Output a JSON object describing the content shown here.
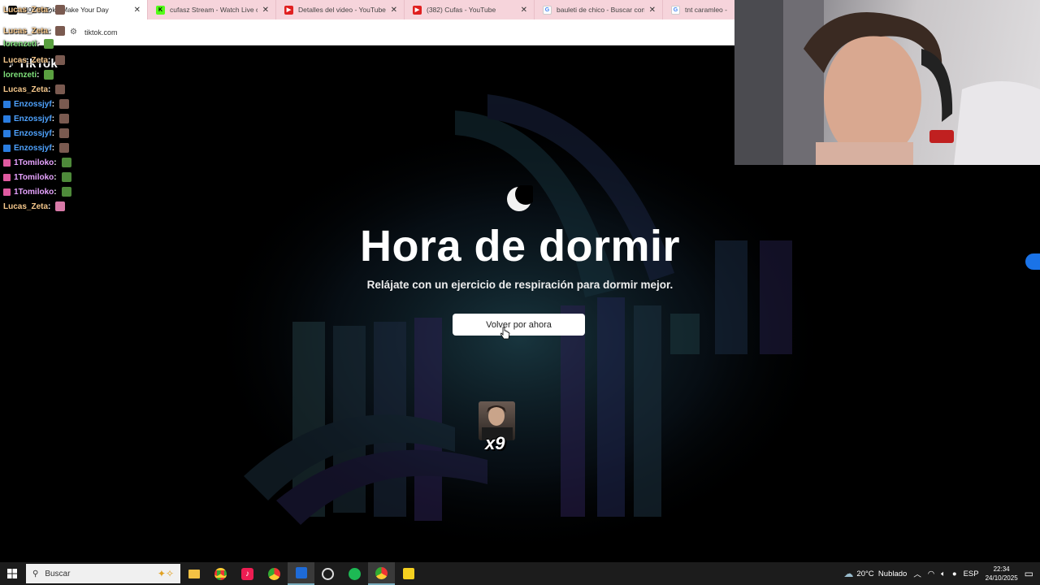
{
  "browser": {
    "tabs": [
      {
        "label": "(40) TikTok - Make Your Day",
        "favicon": "tiktok-icon",
        "active": true
      },
      {
        "label": "cufasz Stream - Watch Live on K",
        "favicon": "kick-icon",
        "active": false
      },
      {
        "label": "Detalles del video - YouTube St",
        "favicon": "youtube-icon",
        "active": false
      },
      {
        "label": "(382) Cufas - YouTube",
        "favicon": "youtube-icon",
        "active": false
      },
      {
        "label": "bauleti de chico - Buscar con G",
        "favicon": "google-icon",
        "active": false
      },
      {
        "label": "tnt caramleo - Bus",
        "favicon": "google-icon",
        "active": false
      }
    ],
    "url": "tiktok.com"
  },
  "chat": [
    {
      "user": "Lucas_Zeta",
      "color": "#f6c88c",
      "badge": "",
      "emote": "face"
    },
    {
      "user": "Lucas_Zeta",
      "color": "#f6c88c",
      "badge": "",
      "emote": "face"
    },
    {
      "user": "lorenzeti",
      "color": "#7ee07a",
      "badge": "",
      "emote": "pepe"
    },
    {
      "user": "Lucas_Zeta",
      "color": "#f6c88c",
      "badge": "",
      "emote": "face"
    },
    {
      "user": "lorenzeti",
      "color": "#7ee07a",
      "badge": "",
      "emote": "pepe"
    },
    {
      "user": "Lucas_Zeta",
      "color": "#f6c88c",
      "badge": "",
      "emote": "face"
    },
    {
      "user": "Enzossjyf",
      "color": "#4fa3ff",
      "badge": "#2a7de1",
      "emote": "face"
    },
    {
      "user": "Enzossjyf",
      "color": "#4fa3ff",
      "badge": "#2a7de1",
      "emote": "face"
    },
    {
      "user": "Enzossjyf",
      "color": "#4fa3ff",
      "badge": "#2a7de1",
      "emote": "face"
    },
    {
      "user": "Enzossjyf",
      "color": "#4fa3ff",
      "badge": "#2a7de1",
      "emote": "face"
    },
    {
      "user": "1Tomiloko",
      "color": "#e7a3ff",
      "badge": "#e05aa0",
      "emote": "frog"
    },
    {
      "user": "1Tomiloko",
      "color": "#e7a3ff",
      "badge": "#e05aa0",
      "emote": "frog"
    },
    {
      "user": "1Tomiloko",
      "color": "#e7a3ff",
      "badge": "#e05aa0",
      "emote": "frog"
    },
    {
      "user": "Lucas_Zeta",
      "color": "#f6c88c",
      "badge": "",
      "emote": "pink"
    }
  ],
  "chat_separator": " :",
  "tiktok_logo": "TikTok",
  "main": {
    "title": "Hora de dormir",
    "subtitle": "Relájate con un ejercicio de respiración para dormir mejor.",
    "back_button": "Volver por ahora"
  },
  "overlay": {
    "emote_count": "x9"
  },
  "taskbar": {
    "search_placeholder": "Buscar",
    "weather": "20°C  Nublado",
    "language": "ESP",
    "time": "22:34",
    "date": "24/10/2025"
  },
  "colors": {
    "accent_blue": "#1a73e8",
    "tab_bar": "#f6d4db"
  }
}
